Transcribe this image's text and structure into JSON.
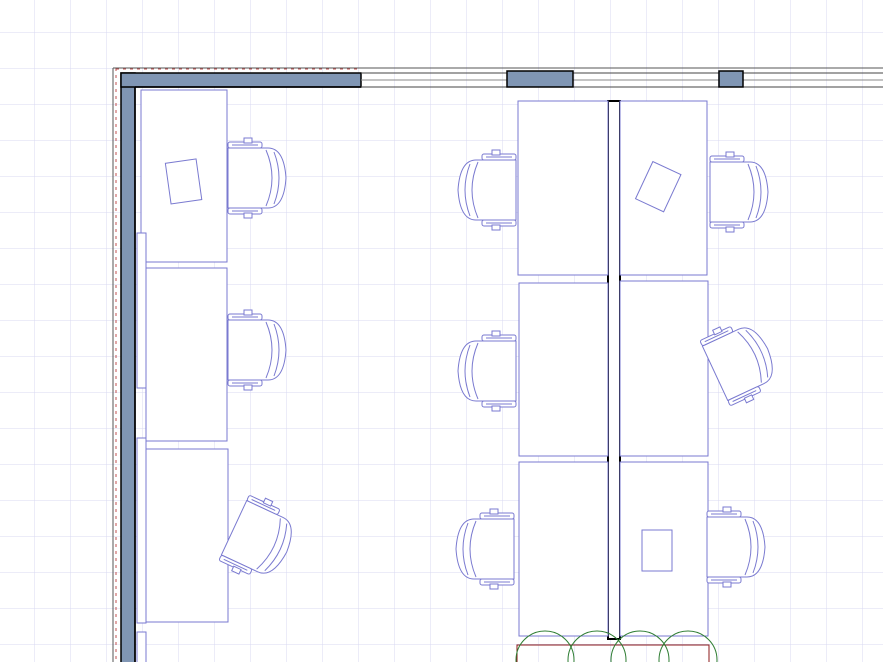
{
  "canvas": {
    "background": "#ffffff",
    "grid_color": "#d8d8f2",
    "wall_fill": "#8096b4",
    "wall_stroke": "#000000",
    "furniture_stroke": "#7a7ad0",
    "hatch_color": "#c05050",
    "plant_color": "#2e7d32",
    "plant_box_color": "#8b1a1a"
  },
  "elements": {
    "walls": [
      "exterior-wall-west",
      "exterior-wall-north",
      "window-wall-segment",
      "window-wall-segment",
      "center-partition"
    ],
    "desks": 9,
    "chairs": 9,
    "papers": 2,
    "notebooks": 1,
    "plants": 4
  }
}
